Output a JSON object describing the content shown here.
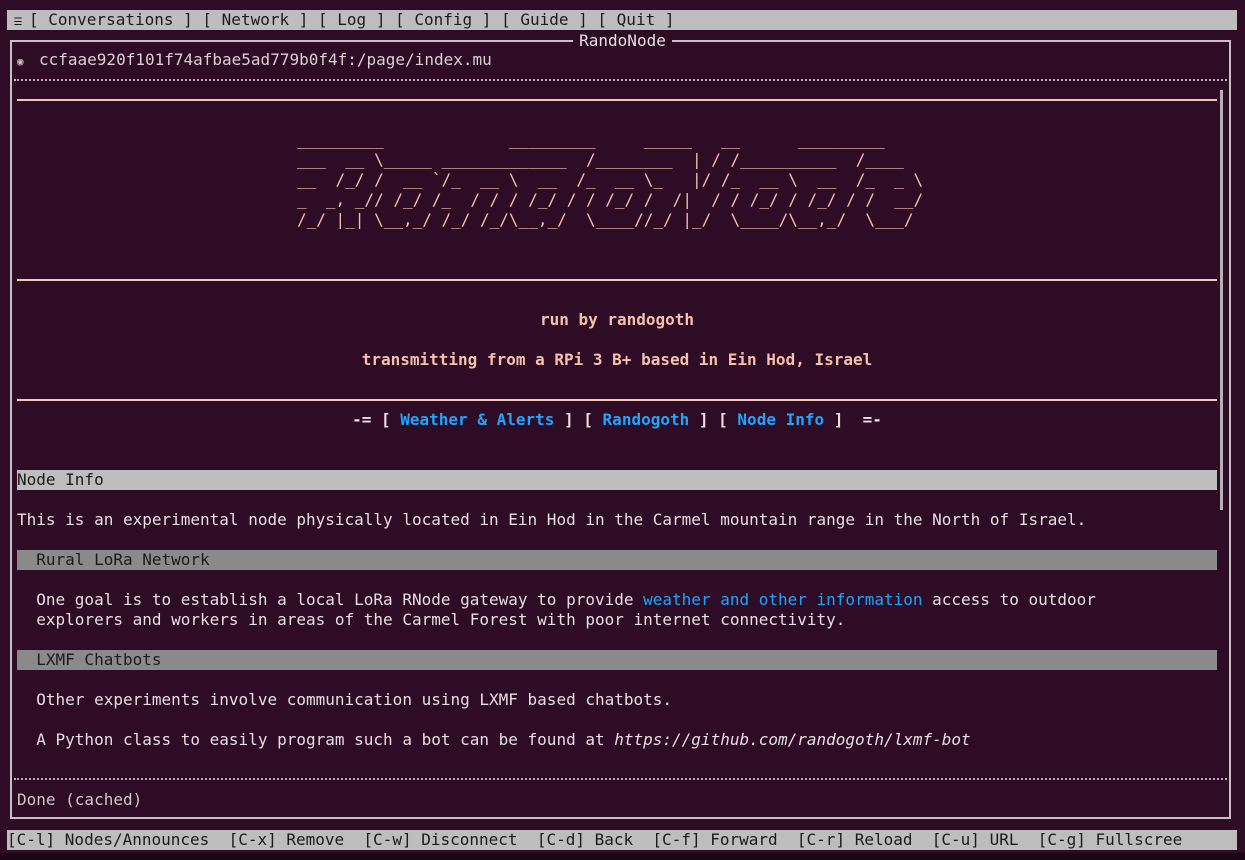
{
  "menu": {
    "icon": "hamburger-icon",
    "items": [
      "[ Conversations ]",
      "[ Network ]",
      "[ Log ]",
      "[ Config ]",
      "[ Guide ]",
      "[ Quit ]"
    ]
  },
  "window": {
    "title": "RandoNode"
  },
  "address": {
    "icon": "globe-icon",
    "url": "ccfaae920f101f74afbae5ad779b0f4f:/page/index.mu"
  },
  "page": {
    "ascii_art": [
      "_________             _________     _____   __      _________",
      "___  __ \\_____ _____________  /________  | / /__________  /____",
      "__  /_/ /  __ `/_  __ \\  __  /_  __ \\_   |/ /_  __ \\  __  /_  _ \\",
      "_  _, _// /_/ /_  / / / /_/ / / /_/ /  /|  / / /_/ / /_/ / /  __/",
      "/_/ |_| \\__,_/ /_/ /_/\\__,_/  \\____//_/ |_/  \\____/\\__,_/  \\___/"
    ],
    "run_by": "run by randogoth",
    "transmitting": "transmitting from a RPi 3 B+ based in Ein Hod, Israel",
    "nav": {
      "prefix": "-= [ ",
      "sep": " ] [ ",
      "suffix": " ]  =-",
      "links": [
        "Weather & Alerts",
        "Randogoth",
        "Node Info"
      ]
    },
    "section_title": "Node Info",
    "intro": "This is an experimental node physically located in Ein Hod in the Carmel mountain range in the North of Israel.",
    "rural": {
      "heading": "  Rural LoRa Network",
      "text_before": "  One goal is to establish a local LoRa RNode gateway to provide ",
      "link": "weather and other information",
      "text_after": " access to outdoor",
      "line2": "  explorers and workers in areas of the Carmel Forest with poor internet connectivity."
    },
    "lxmf": {
      "heading": "  LXMF Chatbots",
      "line1": "  Other experiments involve communication using LXMF based chatbots.",
      "line2_before": "  A Python class to easily program such a bot can be found at ",
      "line2_url": "https://github.com/randogoth/lxmf-bot"
    }
  },
  "status": "Done (cached)",
  "shortcuts": [
    "[C-l] Nodes/Announces",
    "[C-x] Remove",
    "[C-w] Disconnect",
    "[C-d] Back",
    "[C-f] Forward",
    "[C-r] Reload",
    "[C-u] URL",
    "[C-g] Fullscree"
  ],
  "colors": {
    "background": "#2e0c26",
    "accent_link": "#1ea5ff",
    "ascii": "#f5c1ad",
    "bar": "#bdbdbd"
  }
}
